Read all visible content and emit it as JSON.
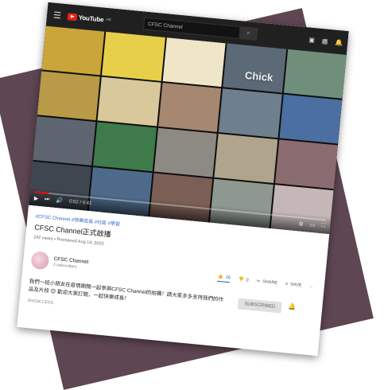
{
  "header": {
    "logo_text": "YouTube",
    "logo_region": "HK",
    "search_value": "CFSC Channel"
  },
  "player": {
    "tile_caption": "Chick",
    "time": "0:02 / 0:41",
    "progress": 0.05
  },
  "video": {
    "hashtags": "#CFSC Channel #快樂成長 #社區 #學習",
    "title": "CFSC Channel正式啟播",
    "meta": "242 views • Premiered Aug 14, 2020",
    "likes": "16",
    "dislikes": "0",
    "share_label": "SHARE",
    "save_label": "SAVE",
    "more_label": "..."
  },
  "channel": {
    "name": "CFSC Channel",
    "subscribers": "2 subscribers",
    "subscribe_label": "SUBSCRIBED"
  },
  "description": {
    "text": "我們一班小朋友在疫情期間一起參與CFSC Channel的拍攝！請大家多多支持我們的作品及片段 😊 歡迎大家訂閱，一起快樂成長！",
    "show_more": "SHOW LESS"
  },
  "colors": {
    "accent_red": "#e62117",
    "link_blue": "#3366cc",
    "backdrop": "#5e4652"
  }
}
